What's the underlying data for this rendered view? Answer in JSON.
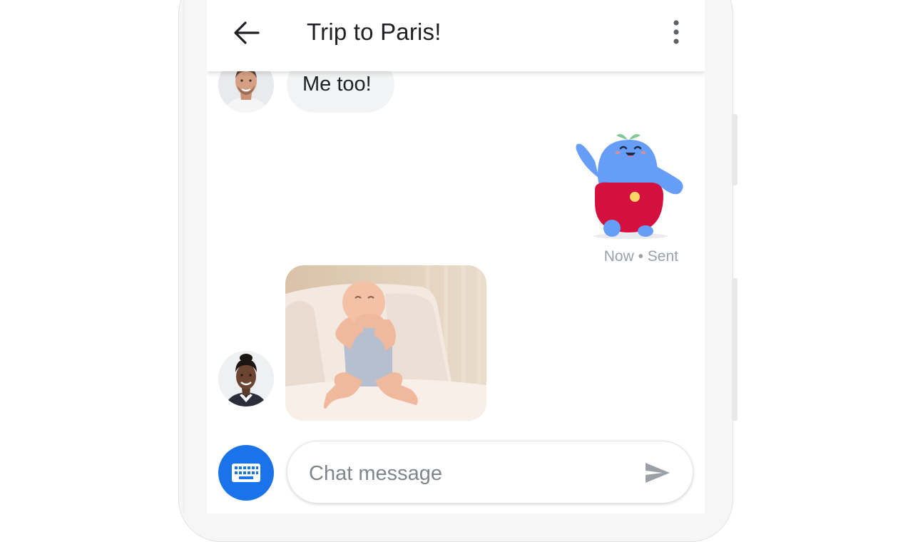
{
  "header": {
    "title": "Trip to Paris!",
    "back_icon": "arrow-back-icon",
    "menu_icon": "more-vert-icon"
  },
  "messages": [
    {
      "type": "text",
      "sender_avatar": "avatar-man",
      "text": "Me too!"
    },
    {
      "type": "sticker",
      "sticker": "blue-blob-waving-sticker",
      "status": "Now • Sent"
    },
    {
      "type": "image",
      "sender_avatar": "avatar-woman",
      "image": "baby-sitting-photo"
    }
  ],
  "compose": {
    "placeholder": "Chat message",
    "keyboard_icon": "keyboard-icon",
    "send_icon": "send-icon"
  },
  "colors": {
    "accent": "#1a73e8",
    "bubble_incoming": "#f1f3f4",
    "status_text": "#9aa0a6",
    "sticker_blue": "#669df6",
    "sticker_red": "#d50f3e"
  }
}
